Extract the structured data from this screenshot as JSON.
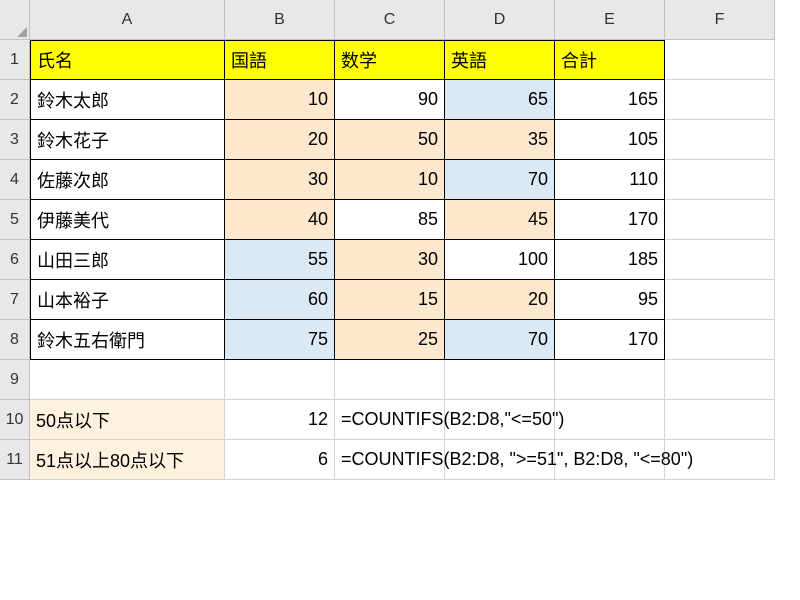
{
  "columns": [
    "A",
    "B",
    "C",
    "D",
    "E",
    "F"
  ],
  "rows": [
    "1",
    "2",
    "3",
    "4",
    "5",
    "6",
    "7",
    "8",
    "9",
    "10",
    "11"
  ],
  "headers": {
    "A": "氏名",
    "B": "国語",
    "C": "数学",
    "D": "英語",
    "E": "合計"
  },
  "data_rows": [
    {
      "name": "鈴木太郎",
      "b": "10",
      "c": "90",
      "d": "65",
      "e": "165",
      "bCls": "lorange",
      "cCls": "",
      "dCls": "lblue"
    },
    {
      "name": "鈴木花子",
      "b": "20",
      "c": "50",
      "d": "35",
      "e": "105",
      "bCls": "lorange",
      "cCls": "lorange",
      "dCls": "lorange"
    },
    {
      "name": "佐藤次郎",
      "b": "30",
      "c": "10",
      "d": "70",
      "e": "110",
      "bCls": "lorange",
      "cCls": "lorange",
      "dCls": "lblue"
    },
    {
      "name": "伊藤美代",
      "b": "40",
      "c": "85",
      "d": "45",
      "e": "170",
      "bCls": "lorange",
      "cCls": "",
      "dCls": "lorange"
    },
    {
      "name": "山田三郎",
      "b": "55",
      "c": "30",
      "d": "100",
      "e": "185",
      "bCls": "lblue",
      "cCls": "lorange",
      "dCls": ""
    },
    {
      "name": "山本裕子",
      "b": "60",
      "c": "15",
      "d": "20",
      "e": "95",
      "bCls": "lblue",
      "cCls": "lorange",
      "dCls": "lorange"
    },
    {
      "name": "鈴木五右衛門",
      "b": "75",
      "c": "25",
      "d": "70",
      "e": "170",
      "bCls": "lblue",
      "cCls": "lorange",
      "dCls": "lblue"
    }
  ],
  "summary": [
    {
      "label": "50点以下",
      "value": "12",
      "formula": "=COUNTIFS(B2:D8,\"<=50\")"
    },
    {
      "label": "51点以上80点以下",
      "value": "6",
      "formula": "=COUNTIFS(B2:D8, \">=51\", B2:D8, \"<=80\")"
    }
  ],
  "chart_data": {
    "type": "table",
    "title": "",
    "columns": [
      "氏名",
      "国語",
      "数学",
      "英語",
      "合計"
    ],
    "rows": [
      [
        "鈴木太郎",
        10,
        90,
        65,
        165
      ],
      [
        "鈴木花子",
        20,
        50,
        35,
        105
      ],
      [
        "佐藤次郎",
        30,
        10,
        70,
        110
      ],
      [
        "伊藤美代",
        40,
        85,
        45,
        170
      ],
      [
        "山田三郎",
        55,
        30,
        100,
        185
      ],
      [
        "山本裕子",
        60,
        15,
        20,
        95
      ],
      [
        "鈴木五右衛門",
        75,
        25,
        70,
        170
      ]
    ],
    "summary": [
      {
        "label": "50点以下",
        "count": 12,
        "formula": "=COUNTIFS(B2:D8,\"<=50\")"
      },
      {
        "label": "51点以上80点以下",
        "count": 6,
        "formula": "=COUNTIFS(B2:D8, \">=51\", B2:D8, \"<=80\")"
      }
    ]
  }
}
